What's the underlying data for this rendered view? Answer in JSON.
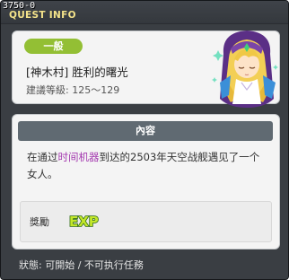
{
  "window": {
    "quest_id": "3750-0",
    "title": "QUEST INFO"
  },
  "header": {
    "type_badge": "一般",
    "quest_name": "[神木村] 胜利的曙光",
    "level_range": "建議等級: 125～129"
  },
  "content": {
    "header": "內容",
    "desc_before": "在通过",
    "desc_highlight": "时间机器",
    "desc_after": "到达的2503年天空战舰遇见了一个女人。"
  },
  "reward": {
    "label": "獎勵",
    "exp_text": "EXP"
  },
  "status": {
    "text": "狀態: 可開始 / 不可执行任務"
  },
  "colors": {
    "badge": "#93bf34",
    "highlight": "#a43aaf",
    "title": "#f4e38a",
    "exp": "#c4e82a"
  },
  "icons": {
    "portrait": "npc-portrait-icon",
    "exp": "exp-icon"
  }
}
